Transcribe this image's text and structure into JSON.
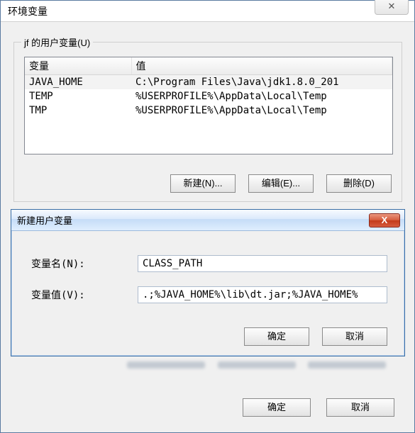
{
  "window": {
    "title": "环境变量",
    "close_glyph": "✕"
  },
  "group": {
    "label": "jf 的用户变量(U)",
    "columns": {
      "name": "变量",
      "value": "值"
    },
    "rows": [
      {
        "name": "JAVA_HOME",
        "value": "C:\\Program Files\\Java\\jdk1.8.0_201"
      },
      {
        "name": "TEMP",
        "value": "%USERPROFILE%\\AppData\\Local\\Temp"
      },
      {
        "name": "TMP",
        "value": "%USERPROFILE%\\AppData\\Local\\Temp"
      }
    ],
    "buttons": {
      "new": "新建(N)...",
      "edit": "编辑(E)...",
      "delete": "删除(D)"
    }
  },
  "modal": {
    "title": "新建用户变量",
    "close_glyph": "X",
    "name_label": "变量名(N):",
    "value_label": "变量值(V):",
    "name_value": "CLASS_PATH",
    "value_value": ".;%JAVA_HOME%\\lib\\dt.jar;%JAVA_HOME%",
    "ok_label": "确定",
    "cancel_label": "取消"
  },
  "footer": {
    "ok_label": "确定",
    "cancel_label": "取消"
  }
}
